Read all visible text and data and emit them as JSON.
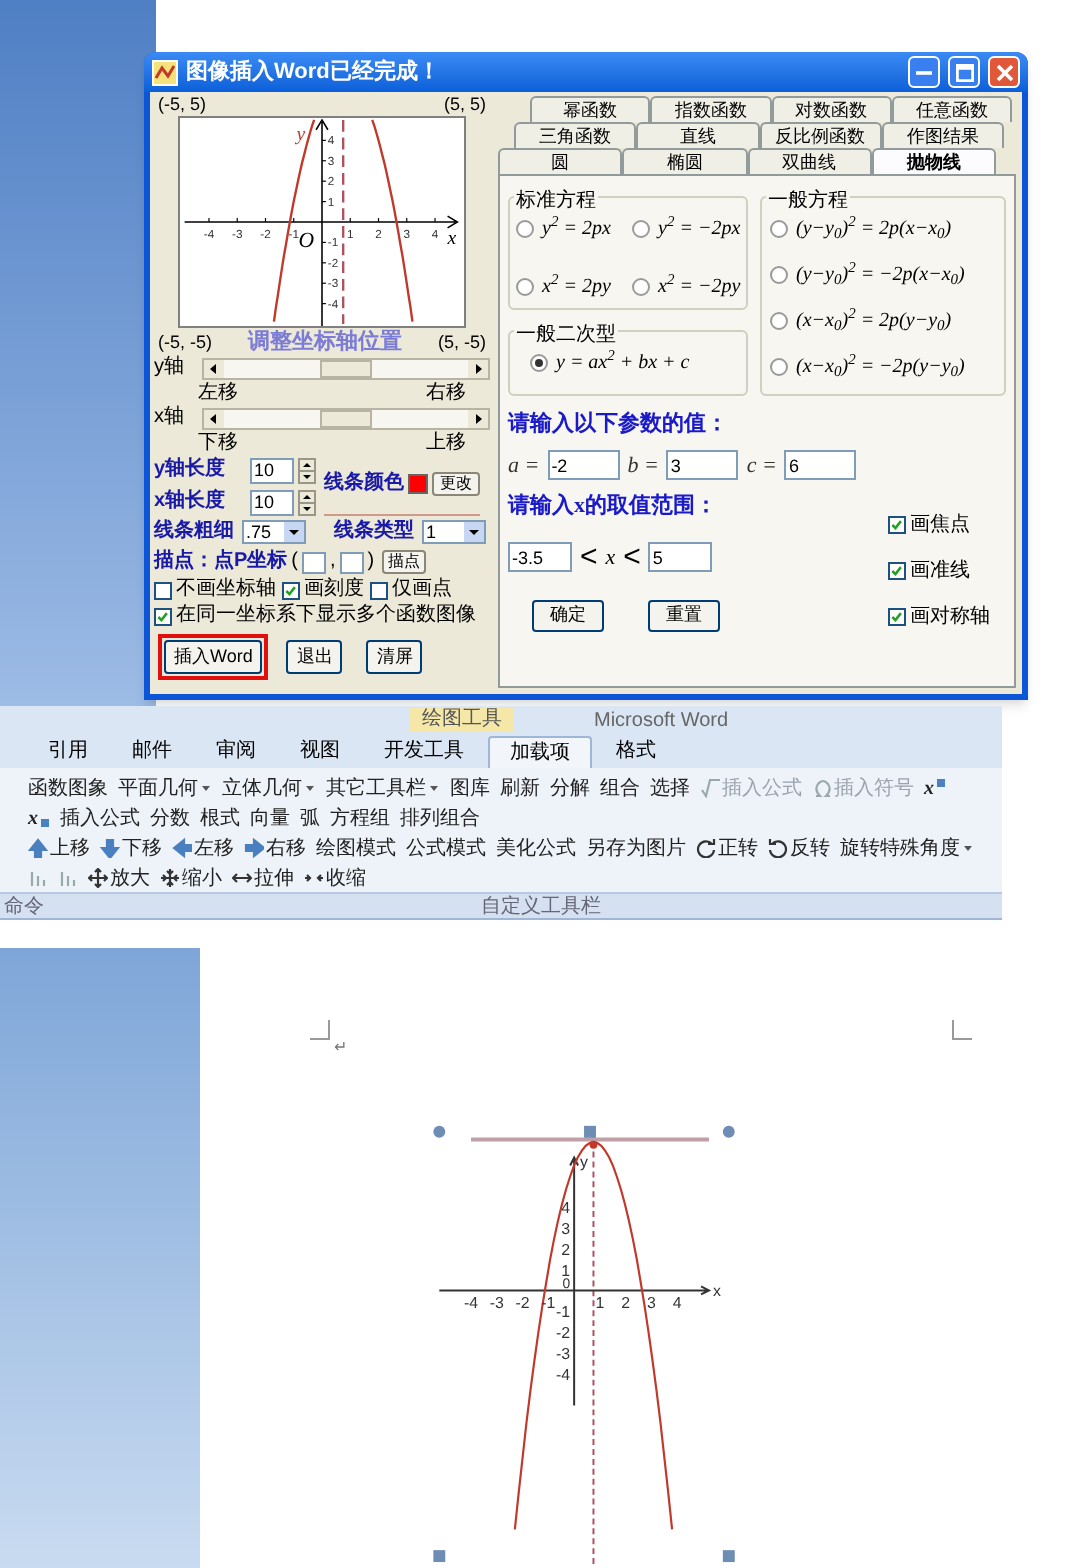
{
  "dialog": {
    "title": "图像插入Word已经完成！",
    "graph": {
      "top_left": "(-5, 5)",
      "top_right": "(5, 5)",
      "bottom_left": "(-5, -5)",
      "bottom_right": "(5, -5)",
      "x_label": "x",
      "y_label": "y",
      "origin": "O",
      "x_ticks": [
        "-4",
        "-3",
        "-2",
        "-1",
        "1",
        "2",
        "3",
        "4"
      ],
      "y_ticks": [
        "4",
        "3",
        "2",
        "1",
        "-1",
        "-2",
        "-3",
        "-4"
      ]
    },
    "adjust_label": "调整坐标轴位置",
    "y_axis_slider": {
      "label": "y轴",
      "level": 0.5
    },
    "x_hints": [
      "左移",
      "右移"
    ],
    "x_axis_slider": {
      "label": "x轴",
      "level": 0.5
    },
    "y_hints": [
      "下移",
      "上移"
    ],
    "y_length": {
      "label": "y轴长度",
      "value": "10"
    },
    "x_length": {
      "label": "x轴长度",
      "value": "10"
    },
    "line_color": {
      "label": "线条颜色",
      "color": "#ff0000",
      "button": "更改"
    },
    "line_width": {
      "label": "线条粗细",
      "value": ".75"
    },
    "line_type": {
      "label": "线条类型",
      "value": "1"
    },
    "plot_point": {
      "label": "描点：点P坐标",
      "open": "(",
      "comma": ",",
      "close": ")",
      "button": "描点"
    },
    "options": [
      {
        "label": "不画坐标轴",
        "checked": false
      },
      {
        "label": "画刻度",
        "checked": true
      },
      {
        "label": "仅画点",
        "checked": false
      },
      {
        "label": "在同一坐标系下显示多个函数图像",
        "checked": true
      }
    ],
    "buttons": [
      {
        "label": "插入Word",
        "highlighted": true
      },
      {
        "label": "退出",
        "highlighted": false
      },
      {
        "label": "清屏",
        "highlighted": false
      }
    ],
    "tab_rows": [
      {
        "tabs": [
          {
            "label": "幂函数",
            "selected": false
          },
          {
            "label": "指数函数",
            "selected": false
          },
          {
            "label": "对数函数",
            "selected": false
          },
          {
            "label": "任意函数",
            "selected": false
          }
        ]
      },
      {
        "tabs": [
          {
            "label": "三角函数",
            "selected": false
          },
          {
            "label": "直线",
            "selected": false
          },
          {
            "label": "反比例函数",
            "selected": false
          },
          {
            "label": "作图结果",
            "selected": false
          }
        ]
      },
      {
        "tabs": [
          {
            "label": "圆",
            "selected": false
          },
          {
            "label": "椭圆",
            "selected": false
          },
          {
            "label": "双曲线",
            "selected": false
          },
          {
            "label": "抛物线",
            "selected": true
          }
        ]
      }
    ],
    "standard_group": {
      "title": "标准方程",
      "options": [
        {
          "equation": "y$^{2}$ = 2px",
          "selected": false
        },
        {
          "equation": "y$^{2}$ = −2px",
          "selected": false
        },
        {
          "equation": "x$^{2}$ = 2py",
          "selected": false
        },
        {
          "equation": "x$^{2}$ = −2py",
          "selected": false
        }
      ]
    },
    "quadratic_group": {
      "title": "一般二次型",
      "options": [
        {
          "equation": "y = ax$^{2}$ + bx + c",
          "selected": true
        }
      ]
    },
    "general_group": {
      "title": "一般方程",
      "options": [
        {
          "equation": "(y−y$_{0}$)$^{2}$ = 2p(x−x$_{0}$)",
          "selected": false
        },
        {
          "equation": "(y−y$_{0}$)$^{2}$ = −2p(x−x$_{0}$)",
          "selected": false
        },
        {
          "equation": "(x−x$_{0}$)$^{2}$ = 2p(y−y$_{0}$)",
          "selected": false
        },
        {
          "equation": "(x−x$_{0}$)$^{2}$ = −2p(y−y$_{0}$)",
          "selected": false
        }
      ]
    },
    "param_prompt": "请输入以下参数的值：",
    "params": [
      {
        "label": "a =",
        "value": "-2"
      },
      {
        "label": "b =",
        "value": "3"
      },
      {
        "label": "c =",
        "value": "6"
      }
    ],
    "range_prompt": "请输入x的取值范围：",
    "range": {
      "min": "-3.5",
      "less_1": "<",
      "variable": "x",
      "less_2": "<",
      "max": "5"
    },
    "draw_options": [
      {
        "label": "画焦点",
        "checked": true
      },
      {
        "label": "画准线",
        "checked": true
      },
      {
        "label": "画对称轴",
        "checked": true
      }
    ],
    "actions": [
      "确定",
      "重置"
    ]
  },
  "ribbon": {
    "context_label": "绘图工具",
    "title": "Microsoft Word",
    "tabs": [
      {
        "label": "引用",
        "selected": false
      },
      {
        "label": "邮件",
        "selected": false
      },
      {
        "label": "审阅",
        "selected": false
      },
      {
        "label": "视图",
        "selected": false
      },
      {
        "label": "开发工具",
        "selected": false
      },
      {
        "label": "加载项",
        "selected": true
      },
      {
        "label": "格式",
        "selected": false
      }
    ],
    "rows": [
      {
        "items": [
          {
            "kind": "plain",
            "label": "函数图象"
          },
          {
            "kind": "dropdown",
            "label": "平面几何"
          },
          {
            "kind": "dropdown",
            "label": "立体几何"
          },
          {
            "kind": "dropdown",
            "label": "其它工具栏"
          },
          {
            "kind": "plain",
            "label": "图库"
          },
          {
            "kind": "plain",
            "label": "刷新"
          },
          {
            "kind": "plain",
            "label": "分解"
          },
          {
            "kind": "plain",
            "label": "组合"
          },
          {
            "kind": "plain",
            "label": "选择"
          },
          {
            "kind": "formula_disabled",
            "label": "插入公式"
          },
          {
            "kind": "symbol_disabled",
            "label": "插入符号"
          },
          {
            "kind": "superscript",
            "label": "x"
          },
          {
            "kind": "subscript",
            "label": "x"
          },
          {
            "kind": "plain",
            "label": "插入公式"
          },
          {
            "kind": "plain",
            "label": "分数"
          },
          {
            "kind": "plain",
            "label": "根式"
          },
          {
            "kind": "plain",
            "label": "向量"
          },
          {
            "kind": "plain",
            "label": "弧"
          },
          {
            "kind": "plain",
            "label": "方程组"
          },
          {
            "kind": "plain",
            "label": "排列组合"
          }
        ]
      },
      {
        "items": [
          {
            "kind": "up",
            "label": "上移"
          },
          {
            "kind": "down",
            "label": "下移"
          },
          {
            "kind": "left",
            "label": "左移"
          },
          {
            "kind": "right",
            "label": "右移"
          },
          {
            "kind": "plain",
            "label": "绘图模式"
          },
          {
            "kind": "plain",
            "label": "公式模式"
          },
          {
            "kind": "plain",
            "label": "美化公式"
          },
          {
            "kind": "plain",
            "label": "另存为图片"
          },
          {
            "kind": "rotate_cw",
            "label": "正转"
          },
          {
            "kind": "rotate_ccw",
            "label": "反转"
          },
          {
            "kind": "dropdown",
            "label": "旋转特殊角度"
          },
          {
            "kind": "align_disabled"
          },
          {
            "kind": "align_disabled"
          },
          {
            "kind": "enlarge",
            "label": "放大"
          },
          {
            "kind": "shrink",
            "label": "缩小"
          },
          {
            "kind": "stretch",
            "label": "拉伸"
          },
          {
            "kind": "contract",
            "label": "收缩"
          }
        ]
      }
    ],
    "left_label": "命令",
    "group_label": "自定义工具栏"
  },
  "document": {
    "paragraph_mark": "↵",
    "figure": {
      "x_ticks": [
        "-4",
        "-3",
        "-2",
        "-1",
        "1",
        "2",
        "3",
        "4"
      ],
      "y_ticks": [
        "4",
        "3",
        "2",
        "1",
        "-1",
        "-2",
        "-3",
        "-4"
      ],
      "origin": "0",
      "x_label": "x",
      "y_label": "y"
    }
  }
}
